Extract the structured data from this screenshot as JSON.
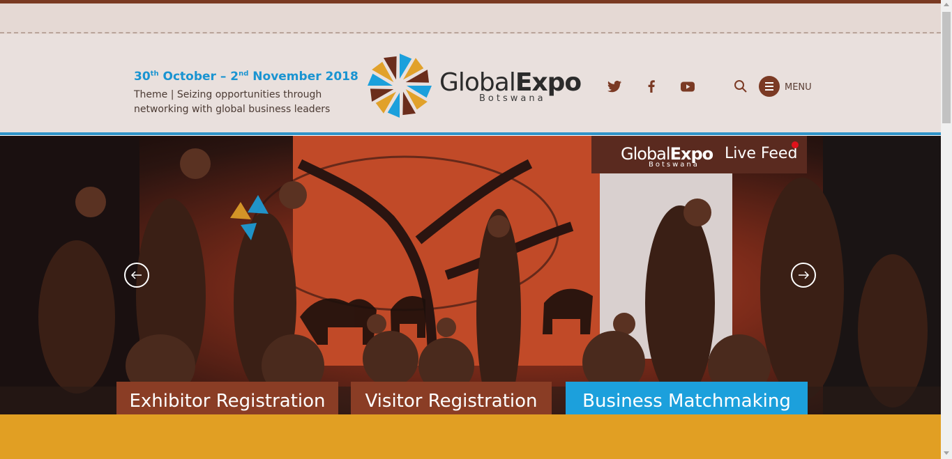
{
  "header": {
    "dates": {
      "start_day": "30",
      "start_sup": "th",
      "start_rest": " October – 2",
      "end_sup": "nd",
      "end_rest": " November 2018"
    },
    "theme": "Theme | Seizing opportunities through networking with global business leaders",
    "logo": {
      "light": "Global",
      "bold": "Expo",
      "sub": "Botswana"
    },
    "social_icons": [
      "twitter-icon",
      "facebook-icon",
      "youtube-icon"
    ],
    "menu_label": "MENU"
  },
  "hero": {
    "live_feed": {
      "logo_light": "Global",
      "logo_bold": "Expo",
      "logo_sub": "Botswana",
      "label": "Live Feed"
    },
    "prev_icon": "arrow-left-icon",
    "next_icon": "arrow-right-icon"
  },
  "cta": {
    "exhibitor": "Exhibitor Registration",
    "visitor": "Visitor Registration",
    "matchmaking": "Business Matchmaking"
  },
  "colors": {
    "brand_brown": "#7b3a24",
    "brand_blue": "#1ca0dc",
    "gold": "#e19f23",
    "dates_blue": "#1a94d1"
  }
}
